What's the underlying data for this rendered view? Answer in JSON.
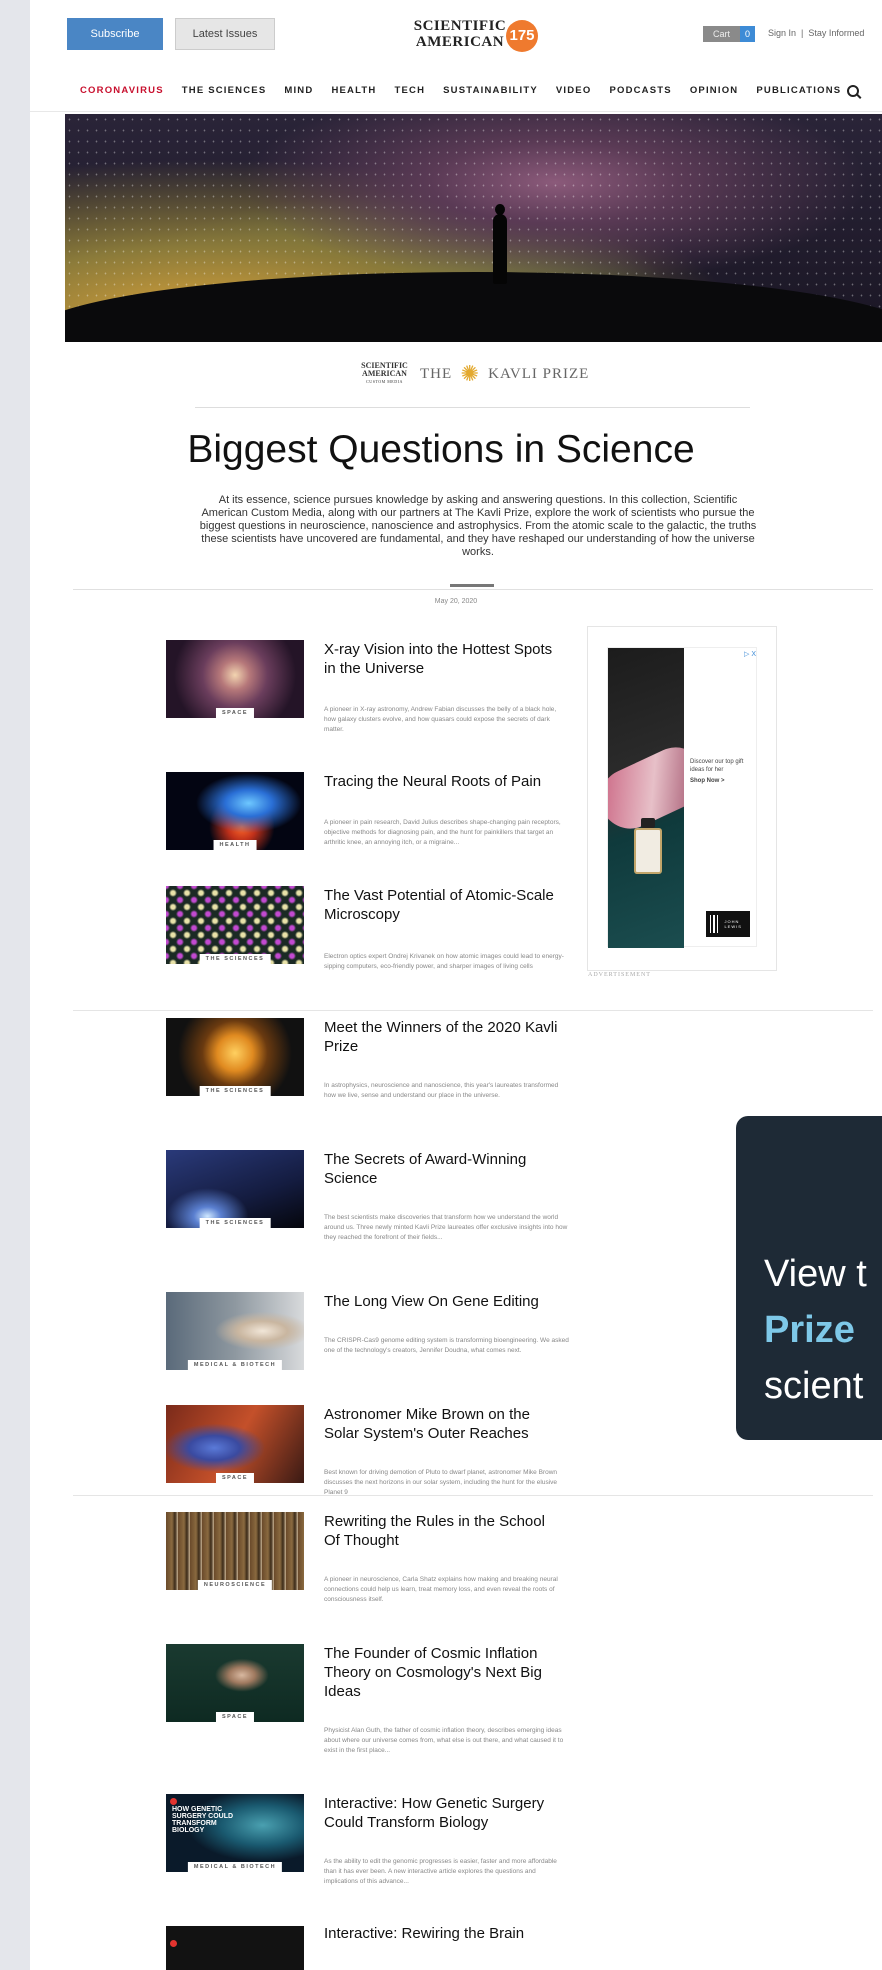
{
  "header": {
    "subscribe_label": "Subscribe",
    "latest_label": "Latest Issues",
    "logo_line1": "SCIENTIFIC",
    "logo_line2": "AMERICAN",
    "logo_badge": "175",
    "cart_label": "Cart",
    "cart_count": "0",
    "sign_in": "Sign In",
    "separator": "|",
    "stay_informed": "Stay Informed"
  },
  "nav": {
    "items": [
      "CORONAVIRUS",
      "THE SCIENCES",
      "MIND",
      "HEALTH",
      "TECH",
      "SUSTAINABILITY",
      "VIDEO",
      "PODCASTS",
      "OPINION",
      "PUBLICATIONS"
    ],
    "highlight_color": "#c8102e"
  },
  "sponsor": {
    "sam_line1": "SCIENTIFIC",
    "sam_line2": "AMERICAN",
    "sam_line3": "CUSTOM MEDIA",
    "the": "THE",
    "kavli": "KAVLI PRIZE"
  },
  "page": {
    "title": "Biggest Questions in Science",
    "intro": "At its essence, science pursues knowledge by asking and answering questions. In this collection, Scientific American Custom Media, along with our partners at The Kavli Prize, explore the work of scientists who pursue the biggest questions in neuroscience, nanoscience and astrophysics. From the atomic scale to the galactic, the truths these scientists have uncovered are fundamental, and they have reshaped our understanding of how the universe works.",
    "date": "May 20, 2020"
  },
  "articles": [
    {
      "title": "X-ray Vision into the Hottest Spots in the Universe",
      "tag": "SPACE",
      "desc": "A pioneer in X-ray astronomy, Andrew Fabian discusses the belly of a black hole, how galaxy clusters evolve, and how quasars could expose the secrets of dark matter."
    },
    {
      "title": "Tracing the Neural Roots of Pain",
      "tag": "HEALTH",
      "desc": "A pioneer in pain research, David Julius describes shape-changing pain receptors, objective methods for diagnosing pain, and the hunt for painkillers that target an arthritic knee, an annoying itch, or a migraine..."
    },
    {
      "title": "The Vast Potential of Atomic-Scale Microscopy",
      "tag": "THE SCIENCES",
      "desc": "Electron optics expert Ondrej Krivanek on how atomic images could lead to energy-sipping computers, eco-friendly power, and sharper images of living cells"
    },
    {
      "title": "Meet the Winners of the 2020 Kavli Prize",
      "tag": "THE SCIENCES",
      "desc": "In astrophysics, neuroscience and nanoscience, this year's laureates transformed how we live, sense and understand our place in the universe."
    },
    {
      "title": "The Secrets of Award-Winning Science",
      "tag": "THE SCIENCES",
      "desc": "The best scientists make discoveries that transform how we understand the world around us. Three newly minted Kavli Prize laureates offer exclusive insights into how they reached the forefront of their fields..."
    },
    {
      "title": "The Long View On Gene Editing",
      "tag": "MEDICAL & BIOTECH",
      "desc": "The CRISPR-Cas9 genome editing system is transforming bioengineering. We asked one of the technology's creators, Jennifer Doudna, what comes next."
    },
    {
      "title": "Astronomer Mike Brown on the Solar System's Outer Reaches",
      "tag": "SPACE",
      "desc": "Best known for driving demotion of Pluto to dwarf planet, astronomer Mike Brown discusses the next horizons in our solar system, including the hunt for the elusive Planet 9"
    },
    {
      "title": "Rewriting the Rules in the School Of Thought",
      "tag": "NEUROSCIENCE",
      "desc": "A pioneer in neuroscience, Carla Shatz explains how making and breaking neural connections could help us learn, treat memory loss, and even reveal the roots of consciousness itself."
    },
    {
      "title": "The Founder of Cosmic Inflation Theory on Cosmology's Next Big Ideas",
      "tag": "SPACE",
      "desc": "Physicist Alan Guth, the father of cosmic inflation theory, describes emerging ideas about where our universe comes from, what else is out there, and what caused it to exist in the first place..."
    },
    {
      "title": "Interactive: How Genetic Surgery Could Transform Biology",
      "tag": "MEDICAL & BIOTECH",
      "desc": "As the ability to edit the genomic progresses is easier, faster and more affordable than it has ever been. A new interactive article explores the questions and implications of this advance...",
      "thumb_text": "HOW GENETIC SURGERY COULD TRANSFORM BIOLOGY"
    },
    {
      "title": "Interactive: Rewiring the Brain",
      "tag": "",
      "desc": ""
    }
  ],
  "ad": {
    "text": "Discover our top gift ideas for her",
    "cta": "Shop Now >",
    "brand": "JOHN LEWIS",
    "marker": "▷ X",
    "label": "ADVERTISEMENT"
  },
  "popup": {
    "line1": "View t",
    "line2": "Prize",
    "line3": "scient"
  },
  "colors": {
    "subscribe": "#4a86c5",
    "popup_bg": "#1e2a36",
    "popup_accent": "#7ec8e8",
    "badge": "#ef7a2e"
  }
}
